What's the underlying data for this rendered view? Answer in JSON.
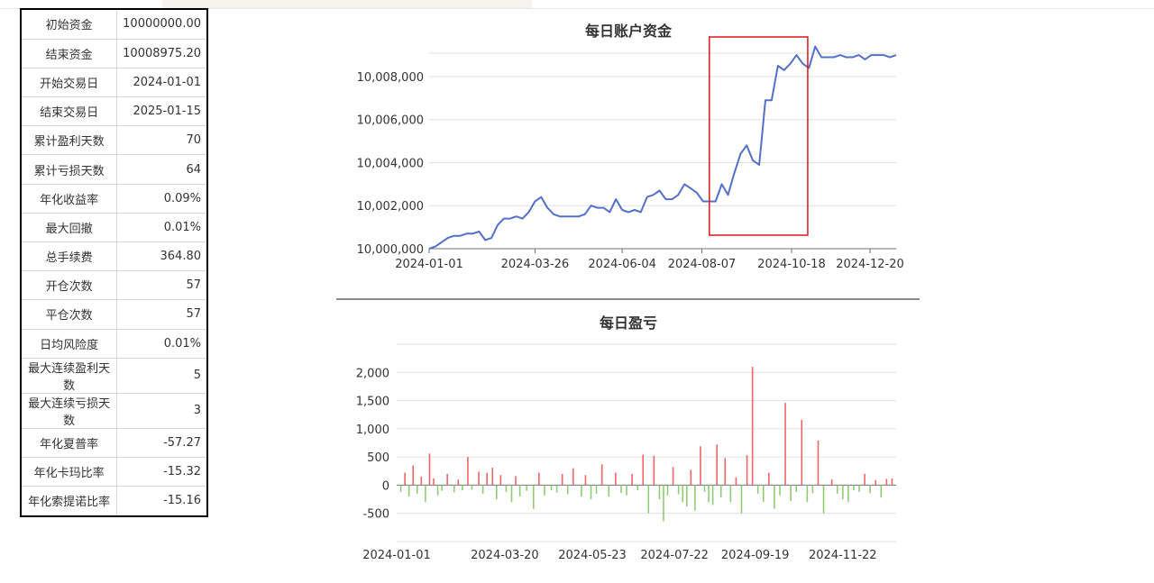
{
  "stats": [
    {
      "label": "初始资金",
      "value": "10000000.00"
    },
    {
      "label": "结束资金",
      "value": "10008975.20"
    },
    {
      "label": "开始交易日",
      "value": "2024-01-01"
    },
    {
      "label": "结束交易日",
      "value": "2025-01-15"
    },
    {
      "label": "累计盈利天数",
      "value": "70"
    },
    {
      "label": "累计亏损天数",
      "value": "64"
    },
    {
      "label": "年化收益率",
      "value": "0.09%"
    },
    {
      "label": "最大回撤",
      "value": "0.01%"
    },
    {
      "label": "总手续费",
      "value": "364.80"
    },
    {
      "label": "开仓次数",
      "value": "57"
    },
    {
      "label": "平仓次数",
      "value": "57"
    },
    {
      "label": "日均风险度",
      "value": "0.01%"
    },
    {
      "label": "最大连续盈利天数",
      "value": "5"
    },
    {
      "label": "最大连续亏损天数",
      "value": "3"
    },
    {
      "label": "年化夏普率",
      "value": "-57.27"
    },
    {
      "label": "年化卡玛比率",
      "value": "-15.32"
    },
    {
      "label": "年化索提诺比率",
      "value": "-15.16"
    }
  ],
  "colors": {
    "line": "#5470c6",
    "profit": "#ee6666",
    "loss": "#91cc75",
    "highlight": "#d7191c"
  },
  "chart_data": [
    {
      "type": "line",
      "title": "每日账户资金",
      "y_ticks": [
        "10,000,000",
        "10,002,000",
        "10,004,000",
        "10,006,000",
        "10,008,000"
      ],
      "x_ticks": [
        "2024-01-01",
        "2024-03-26",
        "2024-06-04",
        "2024-08-07",
        "2024-10-18",
        "2024-12-20"
      ],
      "x_tick_index": [
        0,
        85,
        155,
        219,
        291,
        354
      ],
      "ylim": [
        10000000,
        10009800
      ],
      "highlight_index_range": [
        225,
        304
      ],
      "x": [
        0,
        5,
        10,
        15,
        20,
        25,
        30,
        35,
        40,
        45,
        50,
        55,
        60,
        65,
        70,
        75,
        80,
        85,
        90,
        95,
        100,
        105,
        110,
        115,
        120,
        125,
        130,
        135,
        140,
        145,
        150,
        155,
        160,
        165,
        170,
        175,
        180,
        185,
        190,
        195,
        200,
        205,
        210,
        215,
        220,
        225,
        230,
        235,
        240,
        245,
        250,
        255,
        260,
        265,
        270,
        275,
        280,
        285,
        290,
        295,
        300,
        305,
        310,
        315,
        320,
        325,
        330,
        335,
        340,
        345,
        350,
        355,
        360,
        365,
        370,
        375
      ],
      "values": [
        10000000,
        10000100,
        10000300,
        10000500,
        10000600,
        10000600,
        10000700,
        10000700,
        10000800,
        10000400,
        10000500,
        10001100,
        10001400,
        10001400,
        10001500,
        10001400,
        10001700,
        10002200,
        10002400,
        10001900,
        10001600,
        10001500,
        10001500,
        10001500,
        10001500,
        10001600,
        10002000,
        10001900,
        10001900,
        10001700,
        10002300,
        10001800,
        10001700,
        10001800,
        10001700,
        10002400,
        10002500,
        10002700,
        10002300,
        10002300,
        10002500,
        10003000,
        10002800,
        10002600,
        10002200,
        10002200,
        10002200,
        10003000,
        10002500,
        10003500,
        10004400,
        10004800,
        10004100,
        10003900,
        10006900,
        10006900,
        10008500,
        10008300,
        10008600,
        10009000,
        10008600,
        10008400,
        10009400,
        10008900,
        10008900,
        10008900,
        10009000,
        10008900,
        10008900,
        10009000,
        10008800,
        10009000,
        10009000,
        10009000,
        10008900,
        10009000
      ]
    },
    {
      "type": "bar",
      "title": "每日盈亏",
      "y_ticks": [
        "-500",
        "0",
        "500",
        "1,000",
        "1,500",
        "2,000"
      ],
      "x_ticks": [
        "2024-01-01",
        "2024-03-20",
        "2024-05-23",
        "2024-07-22",
        "2024-09-19",
        "2024-11-22"
      ],
      "x_tick_index": [
        0,
        79,
        143,
        203,
        262,
        326
      ],
      "ylim": [
        -1000,
        2500
      ],
      "x": [
        3,
        6,
        9,
        12,
        15,
        18,
        21,
        24,
        27,
        30,
        33,
        37,
        42,
        45,
        48,
        52,
        55,
        60,
        63,
        66,
        70,
        73,
        76,
        80,
        84,
        87,
        90,
        95,
        100,
        104,
        108,
        113,
        117,
        121,
        125,
        129,
        135,
        138,
        142,
        146,
        150,
        155,
        160,
        164,
        168,
        172,
        176,
        180,
        184,
        188,
        192,
        195,
        198,
        202,
        206,
        209,
        212,
        215,
        218,
        222,
        225,
        228,
        231,
        234,
        237,
        240,
        244,
        248,
        252,
        256,
        260,
        264,
        268,
        272,
        276,
        280,
        284,
        288,
        292,
        296,
        300,
        304,
        308,
        312,
        318,
        322,
        326,
        330,
        334,
        338,
        342,
        346,
        350,
        354,
        358,
        362
      ],
      "values": [
        -120,
        220,
        -200,
        350,
        -150,
        150,
        -300,
        560,
        120,
        -180,
        -100,
        200,
        -130,
        100,
        -90,
        500,
        -80,
        240,
        -150,
        220,
        310,
        -250,
        180,
        -120,
        -300,
        160,
        -200,
        -100,
        -420,
        220,
        -180,
        -90,
        -130,
        200,
        -160,
        300,
        -200,
        180,
        -250,
        -150,
        370,
        -200,
        220,
        -140,
        -180,
        200,
        -90,
        540,
        -500,
        520,
        -250,
        -640,
        -180,
        320,
        -160,
        -300,
        -380,
        270,
        -450,
        690,
        -120,
        -300,
        -350,
        720,
        -220,
        480,
        -300,
        140,
        -500,
        530,
        2100,
        -150,
        -300,
        220,
        -420,
        -180,
        1460,
        -280,
        -120,
        1160,
        -300,
        -140,
        790,
        -500,
        100,
        -150,
        -250,
        -300,
        -90,
        -120,
        200,
        -140,
        90,
        -220,
        110,
        120
      ]
    }
  ]
}
